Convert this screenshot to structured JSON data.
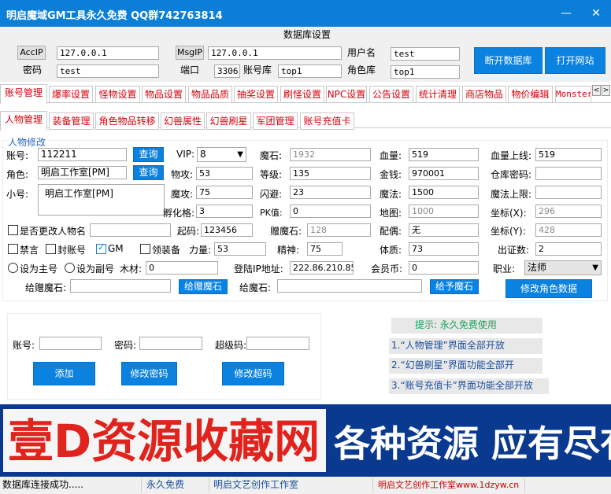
{
  "window": {
    "title": "明启魔域GM工具永久免费 QQ群742763814",
    "min": "—",
    "close": "✕"
  },
  "db": {
    "title": "数据库设置",
    "accip_label": "AccIP",
    "accip": "127.0.0.1",
    "msgip_label": "MsgIP",
    "msgip": "127.0.0.1",
    "user_label": "用户名",
    "user": "test",
    "pwd_label": "密码",
    "pwd": "test",
    "port_label": "端口",
    "port": "3306",
    "acctdb_label": "账号库",
    "acctdb": "top1",
    "roledb_label": "角色库",
    "roledb": "top1",
    "disconnect": "断开数据库",
    "open_site": "打开网站"
  },
  "tabs": [
    "账号管理",
    "爆率设置",
    "怪物设置",
    "物品设置",
    "物品品质",
    "抽奖设置",
    "刷怪设置",
    "NPC设置",
    "公告设置",
    "统计清理",
    "商店物品",
    "物价编辑",
    "Monster.dat"
  ],
  "subtabs": [
    "人物管理",
    "装备管理",
    "角色物品转移",
    "幻兽属性",
    "幻兽刷星",
    "军团管理",
    "账号充值卡"
  ],
  "char": {
    "section": "人物修改",
    "acct_label": "账号:",
    "acct": "112211",
    "query": "查询",
    "role_label": "角色:",
    "role": "明启工作室[PM]",
    "alt_label": "小号:",
    "alt": "明启工作室[PM]",
    "vip_label": "VIP:",
    "vip": "8",
    "mshi_label": "魔石:",
    "mshi": "1932",
    "hp_label": "血量:",
    "hp": "519",
    "hpmax_label": "血量上线:",
    "hpmax": "519",
    "wugong_label": "物攻:",
    "wugong": "53",
    "level_label": "等级:",
    "level": "135",
    "gold_label": "金钱:",
    "gold": "970001",
    "warehouse_label": "仓库密码:",
    "warehouse": "",
    "mogong_label": "魔攻:",
    "mogong": "75",
    "dodge_label": "闪避:",
    "dodge": "23",
    "mana_label": "魔法:",
    "mana": "1500",
    "manamax_label": "魔法上限:",
    "manamax": "",
    "hatch_label": "孵化格:",
    "hatch": "3",
    "pk_label": "PK值:",
    "pk": "0",
    "map_label": "地图:",
    "map": "1000",
    "x_label": "坐标(X):",
    "x": "296",
    "rename_label": "是否更改人物名",
    "rename": "",
    "qima_label": "起码:",
    "qima": "123456",
    "gift_label": "赠魔石:",
    "gift": "128",
    "spouse_label": "配偶:",
    "spouse": "无",
    "y_label": "坐标(Y):",
    "y": "428",
    "ban_label": "禁言",
    "block_label": "封账号",
    "gm_label": "GM",
    "equip_label": "领装备",
    "power_label": "力量:",
    "power": "53",
    "spirit_label": "精神:",
    "spirit": "75",
    "body_label": "体质:",
    "body": "73",
    "cert_label": "出证数:",
    "cert": "2",
    "main_label": "设为主号",
    "sub_label": "设为副号",
    "wood_label": "木材:",
    "wood": "0",
    "loginip_label": "登陆IP地址:",
    "loginip": "222.86.210.85",
    "member_label": "会员币:",
    "member": "0",
    "job_label": "职业:",
    "job": "法师",
    "giftgive_label": "给赠魔石:",
    "giftgive_btn": "给赠魔石",
    "mogive_label": "给魔石:",
    "mogive_btn": "给予魔石",
    "modify_btn": "修改角色数据"
  },
  "acct": {
    "acct_label": "账号:",
    "pwd_label": "密码:",
    "super_label": "超级码:",
    "add": "添加",
    "mod_pwd": "修改密码",
    "mod_super": "修改超码"
  },
  "hints": {
    "title": "提示: 永久免费使用",
    "h1": "1.“人物管理”界面全部开放",
    "h2": "2.“幻兽刷星”界面功能全部开",
    "h3": "3.“账号充值卡”界面功能全部开放"
  },
  "banner": {
    "left": "壹D资源收藏网",
    "right": "各种资源 应有尽有"
  },
  "status": {
    "s1": "数据库连接成功.....",
    "s2": "永久免费",
    "s3": "明启文艺创作工作室",
    "s4": "明启文艺创作工作室www.1dzyw.cn"
  },
  "colors": {
    "titlebar": "#0b7fd8",
    "button": "#0b82e0",
    "tab_text": "#d4000b",
    "banner_bg": "#0a3a8f",
    "banner_left": "#e0231c",
    "banner_right": "#ffffff"
  }
}
